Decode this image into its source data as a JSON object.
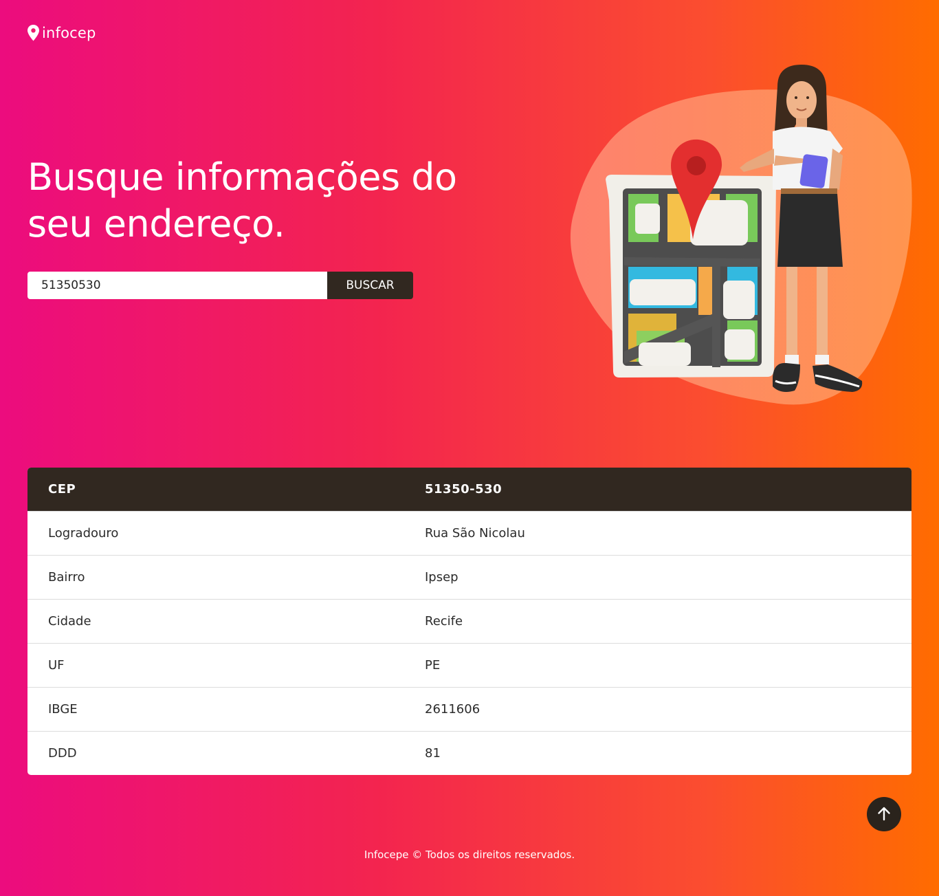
{
  "header": {
    "logo_text": "infocep",
    "logo_icon": "map-pin-icon"
  },
  "hero": {
    "title_line1": "Busque informações do",
    "title_line2": "seu endereço."
  },
  "search": {
    "value": "51350530",
    "button_label": "BUSCAR"
  },
  "illustration": {
    "icon": "woman-with-map-illustration"
  },
  "result": {
    "header": {
      "key": "CEP",
      "value": "51350-530"
    },
    "rows": [
      {
        "key": "Logradouro",
        "value": "Rua São Nicolau"
      },
      {
        "key": "Bairro",
        "value": "Ipsep"
      },
      {
        "key": "Cidade",
        "value": "Recife"
      },
      {
        "key": "UF",
        "value": "PE"
      },
      {
        "key": "IBGE",
        "value": "2611606"
      },
      {
        "key": "DDD",
        "value": "81"
      }
    ]
  },
  "back_to_top": {
    "icon": "arrow-up-icon"
  },
  "footer": {
    "text": "Infocepe © Todos os direitos reservados."
  },
  "colors": {
    "gradient_start": "#ec0c7e",
    "gradient_end": "#ff6c00",
    "dark": "#312820"
  }
}
